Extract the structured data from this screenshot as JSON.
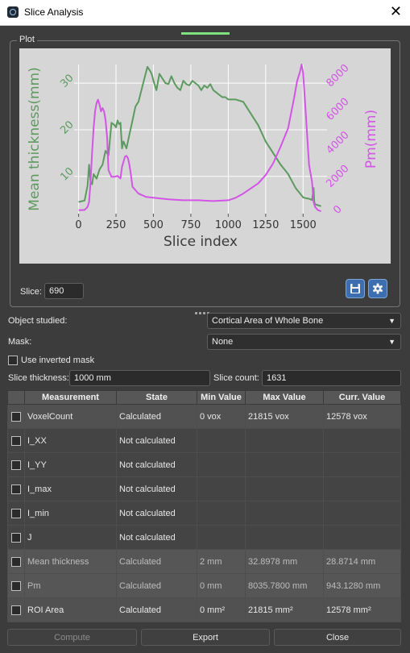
{
  "window": {
    "title": "Slice Analysis",
    "close_glyph": "✕"
  },
  "plot": {
    "group_label": "Plot",
    "slice_label": "Slice:",
    "slice_value": "690",
    "save_icon": "floppy-disk-icon",
    "settings_icon": "gear-icon"
  },
  "chart_data": {
    "type": "line",
    "xlabel": "Slice index",
    "ylabel_left": "Mean thickness(mm)",
    "ylabel_right": "Pm(mm)",
    "xlim": [
      -30,
      1660
    ],
    "ylim_left": [
      2,
      34
    ],
    "ylim_right": [
      -100,
      8800
    ],
    "x_ticks": [
      "0",
      "250",
      "500",
      "750",
      "1000",
      "1250",
      "1500"
    ],
    "y_left_ticks": [
      "10",
      "20",
      "30"
    ],
    "y_right_ticks": [
      "0",
      "2000",
      "4000",
      "6000",
      "8000"
    ],
    "grid": true,
    "colors": {
      "left": "#5c9a5f",
      "right": "#d255e5"
    },
    "series": [
      {
        "axis": "left",
        "x": [
          0,
          40,
          60,
          70,
          80,
          90,
          100,
          120,
          140,
          160,
          180,
          200,
          220,
          240,
          250,
          260,
          270,
          280,
          290,
          300,
          320,
          340,
          360,
          380,
          400,
          420,
          440,
          460,
          480,
          490,
          500,
          520,
          540,
          560,
          580,
          600,
          620,
          640,
          660,
          680,
          700,
          720,
          740,
          760,
          780,
          800,
          820,
          840,
          860,
          880,
          900,
          920,
          940,
          960,
          980,
          1000,
          1050,
          1100,
          1150,
          1200,
          1250,
          1300,
          1350,
          1400,
          1450,
          1500,
          1520,
          1540,
          1560,
          1570,
          1575,
          1580,
          1600,
          1620
        ],
        "y": [
          4.5,
          4.8,
          8,
          12.5,
          8.8,
          8.3,
          10.5,
          9.5,
          11.5,
          12.5,
          15.5,
          14.5,
          21.5,
          21,
          20.5,
          22,
          21.2,
          21.5,
          16,
          17.5,
          16,
          19,
          22,
          25,
          26,
          28.5,
          31,
          33.5,
          32.5,
          31.8,
          30.5,
          28.5,
          32,
          31,
          30,
          29.8,
          31.5,
          30,
          29,
          28.5,
          30.5,
          29.8,
          29.5,
          30.5,
          30,
          29.5,
          28.5,
          29.5,
          29,
          29.8,
          28.5,
          28,
          27.5,
          27,
          27,
          26.5,
          26.5,
          26,
          23.5,
          21,
          17.5,
          15,
          12.5,
          10.5,
          7.5,
          5.5,
          5.3,
          5.2,
          4.9,
          7.5,
          4.5,
          4,
          3.8,
          3.6
        ]
      },
      {
        "axis": "right",
        "x": [
          0,
          40,
          60,
          70,
          80,
          90,
          100,
          110,
          120,
          130,
          140,
          150,
          160,
          170,
          180,
          190,
          200,
          220,
          240,
          260,
          280,
          290,
          300,
          310,
          320,
          330,
          340,
          350,
          360,
          380,
          400,
          450,
          500,
          600,
          700,
          800,
          900,
          1000,
          1050,
          1100,
          1150,
          1200,
          1250,
          1300,
          1350,
          1400,
          1420,
          1440,
          1460,
          1480,
          1490,
          1500,
          1510,
          1520,
          1530,
          1540,
          1560,
          1570,
          1580,
          1600,
          1620
        ],
        "y": [
          100,
          120,
          300,
          600,
          1800,
          3500,
          5000,
          6000,
          6500,
          6700,
          6400,
          6000,
          6200,
          6000,
          5500,
          4500,
          2500,
          2100,
          2100,
          2150,
          2000,
          2700,
          3000,
          3300,
          3350,
          3200,
          2800,
          2200,
          1500,
          1300,
          1100,
          900,
          850,
          750,
          700,
          700,
          650,
          700,
          850,
          1100,
          1400,
          1700,
          2200,
          2900,
          3900,
          5000,
          5900,
          6800,
          7800,
          8400,
          8800,
          8300,
          7000,
          5600,
          4200,
          2800,
          1800,
          600,
          300,
          100,
          50
        ]
      }
    ]
  },
  "form": {
    "object_label": "Object studied:",
    "object_value": "Cortical Area of Whole Bone",
    "mask_label": "Mask:",
    "mask_value": "None",
    "inverted_label": "Use inverted mask",
    "thickness_label": "Slice thickness:",
    "thickness_value": "1000 mm",
    "count_label": "Slice count:",
    "count_value": "1631",
    "dropdown_arrow": "▼"
  },
  "table": {
    "headers": [
      "",
      "Measurement",
      "State",
      "Min Value",
      "Max Value",
      "Curr. Value"
    ],
    "rows": [
      {
        "name": "VoxelCount",
        "state": "Calculated",
        "min": "0 vox",
        "max": "21815 vox",
        "curr": "12578 vox"
      },
      {
        "name": "I_XX",
        "state": "Not calculated",
        "min": "",
        "max": "",
        "curr": ""
      },
      {
        "name": "I_YY",
        "state": "Not calculated",
        "min": "",
        "max": "",
        "curr": ""
      },
      {
        "name": "I_max",
        "state": "Not calculated",
        "min": "",
        "max": "",
        "curr": ""
      },
      {
        "name": "I_min",
        "state": "Not calculated",
        "min": "",
        "max": "",
        "curr": ""
      },
      {
        "name": "J",
        "state": "Not calculated",
        "min": "",
        "max": "",
        "curr": ""
      },
      {
        "name": "Mean thickness",
        "state": "Calculated",
        "min": "2 mm",
        "max": "32.8978 mm",
        "curr": "28.8714 mm"
      },
      {
        "name": "Pm",
        "state": "Calculated",
        "min": "0 mm",
        "max": "8035.7800 mm",
        "curr": "943.1280 mm"
      },
      {
        "name": "ROI Area",
        "state": "Calculated",
        "min": "0 mm²",
        "max": "21815 mm²",
        "curr": "12578 mm²"
      }
    ]
  },
  "buttons": {
    "compute": "Compute",
    "export": "Export",
    "close": "Close"
  }
}
